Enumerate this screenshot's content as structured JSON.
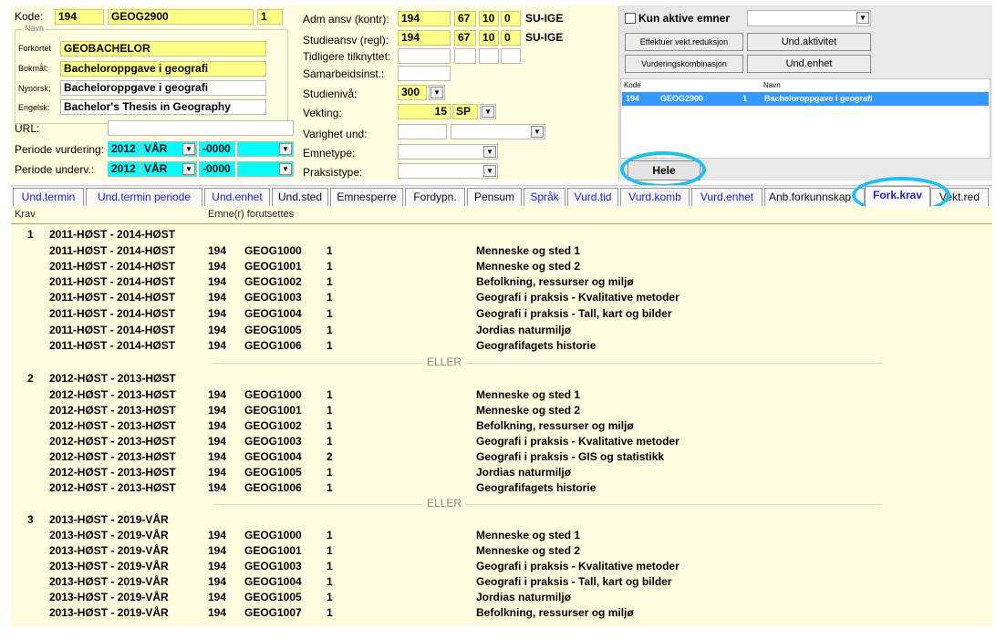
{
  "header": {
    "kode_label": "Kode:",
    "kode_inst": "194",
    "kode_emne": "GEOG2900",
    "kode_versjon": "1",
    "navn_legend": "Navn",
    "forkortet_label": "Forkortet",
    "forkortet": "GEOBACHELOR",
    "bokmal_label": "Bokmål:",
    "bokmal": "Bacheloroppgave i geografi",
    "nynorsk_label": "Nynorsk:",
    "nynorsk": "Bacheloroppgave i geografi",
    "engelsk_label": "Engelsk:",
    "engelsk": "Bachelor's Thesis in Geography",
    "url_label": "URL:",
    "url": "",
    "periode_vurd_label": "Periode vurdering:",
    "periode_vurd_year": "2012",
    "periode_vurd_term": "VÅR",
    "periode_vurd_end": "-0000",
    "periode_und_label": "Periode underv.:",
    "periode_und_year": "2012",
    "periode_und_term": "VÅR",
    "periode_und_end": "-0000"
  },
  "middle": {
    "adm_label": "Adm ansv (kontr):",
    "adm_1": "194",
    "adm_2": "67",
    "adm_3": "10",
    "adm_4": "0",
    "adm_5": "SU-IGE",
    "stud_label": "Studieansv (regl):",
    "stud_1": "194",
    "stud_2": "67",
    "stud_3": "10",
    "stud_4": "0",
    "stud_5": "SU-IGE",
    "tidl_label": "Tidligere tilknyttet:",
    "samarb_label": "Samarbeidsinst.:",
    "niva_label": "Studienivå:",
    "niva": "300",
    "vekting_label": "Vekting:",
    "vekting": "15",
    "vekting_unit": "SP",
    "varighet_label": "Varighet und:",
    "emnetype_label": "Emnetype:",
    "praksis_label": "Praksistype:"
  },
  "right": {
    "kun_aktive_label": "Kun aktive emner",
    "btn_effektuer": "Effektuer vekt.reduksjon",
    "btn_und_aktivitet": "Und.aktivitet",
    "btn_vurd_komb": "Vurderingskombinasjon",
    "btn_und_enhet": "Und.enhet",
    "list_head_kode": "Kode",
    "list_head_navn": "Navn",
    "list_row": {
      "inst": "194",
      "emne": "GEOG2900",
      "versjon": "1",
      "navn": "Bacheloroppgave i geografi"
    },
    "btn_hele": "Hele"
  },
  "tabs": [
    {
      "label": "Und.termin"
    },
    {
      "label": "Und.termin periode"
    },
    {
      "label": "Und.enhet"
    },
    {
      "label": "Und.sted"
    },
    {
      "label": "Emnesperre"
    },
    {
      "label": "Fordypn."
    },
    {
      "label": "Pensum"
    },
    {
      "label": "Språk"
    },
    {
      "label": "Vurd.tid"
    },
    {
      "label": "Vurd.komb"
    },
    {
      "label": "Vurd.enhet"
    },
    {
      "label": "Anb.forkunnskap"
    },
    {
      "label": "Fork.krav"
    },
    {
      "label": "Vekt.red"
    }
  ],
  "content": {
    "col_krav": "Krav",
    "col_emner": "Emne(r) forutsettes",
    "separator": "ELLER",
    "blocks": [
      {
        "num": "1",
        "period": "2011-HØST - 2014-HØST",
        "rows": [
          {
            "period": "2011-HØST - 2014-HØST",
            "inst": "194",
            "code": "GEOG1000",
            "ver": "1",
            "name": "Menneske og sted 1"
          },
          {
            "period": "2011-HØST - 2014-HØST",
            "inst": "194",
            "code": "GEOG1001",
            "ver": "1",
            "name": "Menneske og sted 2"
          },
          {
            "period": "2011-HØST - 2014-HØST",
            "inst": "194",
            "code": "GEOG1002",
            "ver": "1",
            "name": "Befolkning, ressurser og miljø"
          },
          {
            "period": "2011-HØST - 2014-HØST",
            "inst": "194",
            "code": "GEOG1003",
            "ver": "1",
            "name": "Geografi i praksis - Kvalitative metoder"
          },
          {
            "period": "2011-HØST - 2014-HØST",
            "inst": "194",
            "code": "GEOG1004",
            "ver": "1",
            "name": "Geografi i praksis - Tall, kart og bilder"
          },
          {
            "period": "2011-HØST - 2014-HØST",
            "inst": "194",
            "code": "GEOG1005",
            "ver": "1",
            "name": "Jordias naturmiljø"
          },
          {
            "period": "2011-HØST - 2014-HØST",
            "inst": "194",
            "code": "GEOG1006",
            "ver": "1",
            "name": "Geografifagets historie"
          }
        ]
      },
      {
        "num": "2",
        "period": "2012-HØST - 2013-HØST",
        "rows": [
          {
            "period": "2012-HØST - 2013-HØST",
            "inst": "194",
            "code": "GEOG1000",
            "ver": "1",
            "name": "Menneske og sted 1"
          },
          {
            "period": "2012-HØST - 2013-HØST",
            "inst": "194",
            "code": "GEOG1001",
            "ver": "1",
            "name": "Menneske og sted 2"
          },
          {
            "period": "2012-HØST - 2013-HØST",
            "inst": "194",
            "code": "GEOG1002",
            "ver": "1",
            "name": "Befolkning, ressurser og miljø"
          },
          {
            "period": "2012-HØST - 2013-HØST",
            "inst": "194",
            "code": "GEOG1003",
            "ver": "1",
            "name": "Geografi i praksis - Kvalitative metoder"
          },
          {
            "period": "2012-HØST - 2013-HØST",
            "inst": "194",
            "code": "GEOG1004",
            "ver": "2",
            "name": "Geografi i praksis - GIS og statistikk"
          },
          {
            "period": "2012-HØST - 2013-HØST",
            "inst": "194",
            "code": "GEOG1005",
            "ver": "1",
            "name": "Jordias naturmiljø"
          },
          {
            "period": "2012-HØST - 2013-HØST",
            "inst": "194",
            "code": "GEOG1006",
            "ver": "1",
            "name": "Geografifagets historie"
          }
        ]
      },
      {
        "num": "3",
        "period": "2013-HØST - 2019-VÅR",
        "rows": [
          {
            "period": "2013-HØST - 2019-VÅR",
            "inst": "194",
            "code": "GEOG1000",
            "ver": "1",
            "name": "Menneske og sted 1"
          },
          {
            "period": "2013-HØST - 2019-VÅR",
            "inst": "194",
            "code": "GEOG1001",
            "ver": "1",
            "name": "Menneske og sted 2"
          },
          {
            "period": "2013-HØST - 2019-VÅR",
            "inst": "194",
            "code": "GEOG1003",
            "ver": "1",
            "name": "Geografi i praksis - Kvalitative metoder"
          },
          {
            "period": "2013-HØST - 2019-VÅR",
            "inst": "194",
            "code": "GEOG1004",
            "ver": "1",
            "name": "Geografi i praksis - Tall, kart og bilder"
          },
          {
            "period": "2013-HØST - 2019-VÅR",
            "inst": "194",
            "code": "GEOG1005",
            "ver": "1",
            "name": "Jordias naturmiljø"
          },
          {
            "period": "2013-HØST - 2019-VÅR",
            "inst": "194",
            "code": "GEOG1007",
            "ver": "1",
            "name": "Befolkning, ressurser og miljø"
          }
        ]
      }
    ]
  }
}
